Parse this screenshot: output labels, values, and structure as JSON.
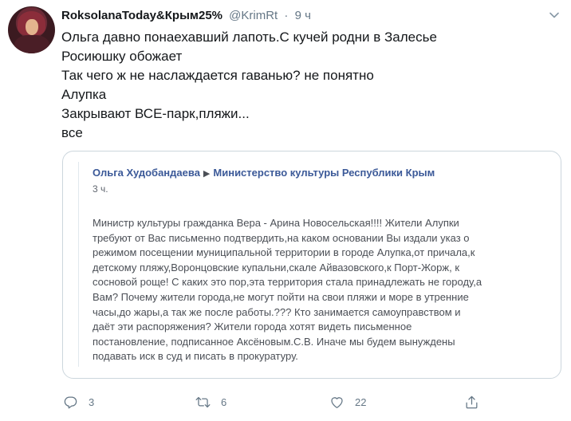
{
  "tweet": {
    "author_name": "RoksolanaToday&Крым25%",
    "handle": "@KrimRt",
    "separator": "·",
    "time": "9 ч",
    "lines": [
      "Ольга давно понаехавший лапоть.С кучей родни в Залесье",
      "Росиюшку обожает",
      "Так чего ж не наслаждается гаванью? не понятно",
      "Алупка",
      "Закрывают ВСЕ-парк,пляжи...",
      "все"
    ]
  },
  "quoted": {
    "author": "Ольга Худобандаева",
    "arrow": "▶",
    "target": "Министерство культуры Республики Крым",
    "time": "3 ч.",
    "lines": [
      "Министр культуры гражданка Вера - Арина Новосельская!!!! Жители Алупки",
      "требуют от Вас письменно подтвердить,на каком основании Вы издали указ о",
      "режимом посещении муниципальной территории в городе Алупка,от причала,к",
      "детскому пляжу,Воронцовские купальни,скале Айвазовского,к Порт-Жорж, к",
      "сосновой роще! С каких это пор,эта территория стала принадлежать не городу,а",
      "Вам? Почему жители города,не могут пойти на свои пляжи и море в утренние",
      "часы,до жары,а так же после работы.??? Кто занимается самоуправством и",
      "даёт эти распоряжения? Жители города хотят видеть письменное",
      "постановление, подписанное Аксёновым.С.В. Иначе мы будем вынуждены",
      "подавать иск в суд и писать в прокуратуру."
    ]
  },
  "actions": {
    "reply_count": "3",
    "retweet_count": "6",
    "like_count": "22"
  },
  "icons": {
    "reply": "reply-icon",
    "retweet": "retweet-icon",
    "like": "heart-icon",
    "share": "share-icon",
    "menu": "chevron-down-icon"
  },
  "colors": {
    "text": "#14171a",
    "muted": "#657786",
    "quote_link": "#3b5998",
    "quote_text": "#4b4f56",
    "border": "#ccd6dd"
  }
}
